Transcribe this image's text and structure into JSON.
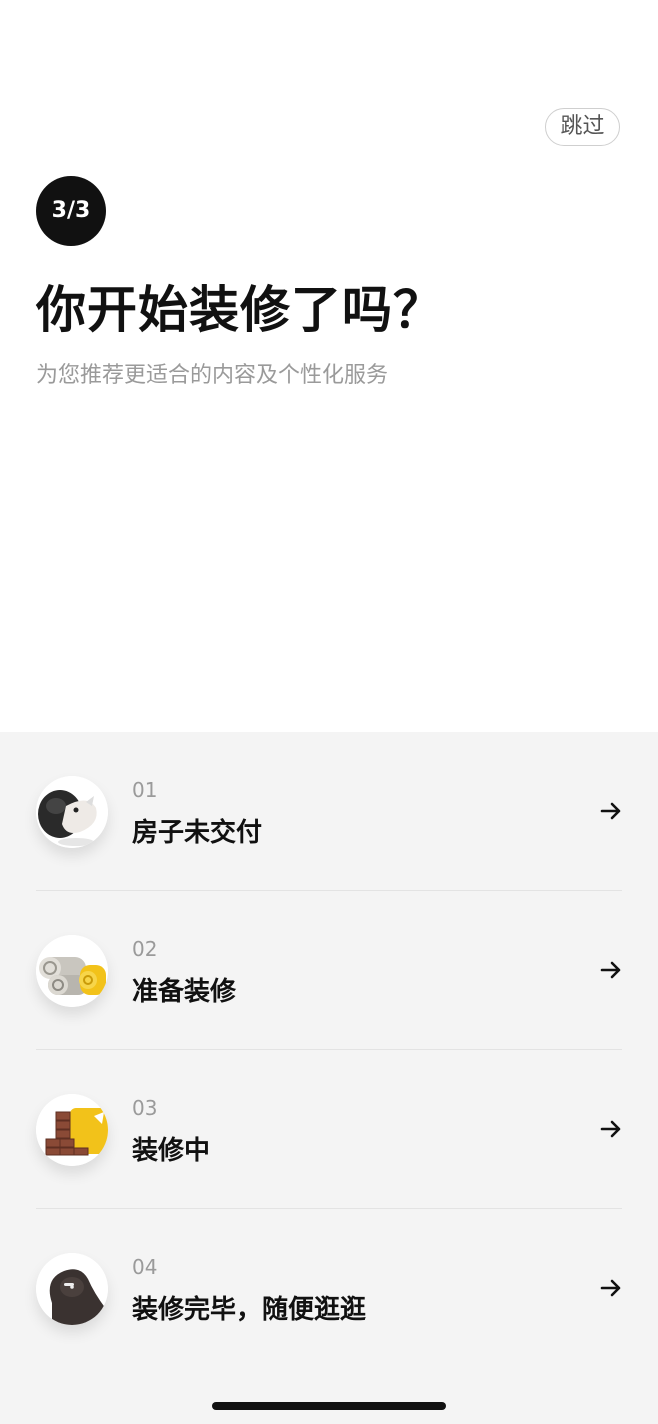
{
  "header": {
    "skip_label": "跳过",
    "step_badge": "3/3",
    "title": "你开始装修了吗？",
    "subtitle": "为您推荐更适合的内容及个性化服务"
  },
  "options": [
    {
      "num": "01",
      "label": "房子未交付",
      "icon": "thinking-character-icon"
    },
    {
      "num": "02",
      "label": "准备装修",
      "icon": "material-rolls-icon"
    },
    {
      "num": "03",
      "label": "装修中",
      "icon": "brick-wall-icon"
    },
    {
      "num": "04",
      "label": "装修完毕，随便逛逛",
      "icon": "relaxed-character-icon"
    }
  ],
  "colors": {
    "panel_bg": "#f4f4f4",
    "badge_bg": "#111111",
    "muted_text": "#9a9a9a",
    "accent_yellow": "#f2c21a",
    "brick": "#8a4a36"
  }
}
